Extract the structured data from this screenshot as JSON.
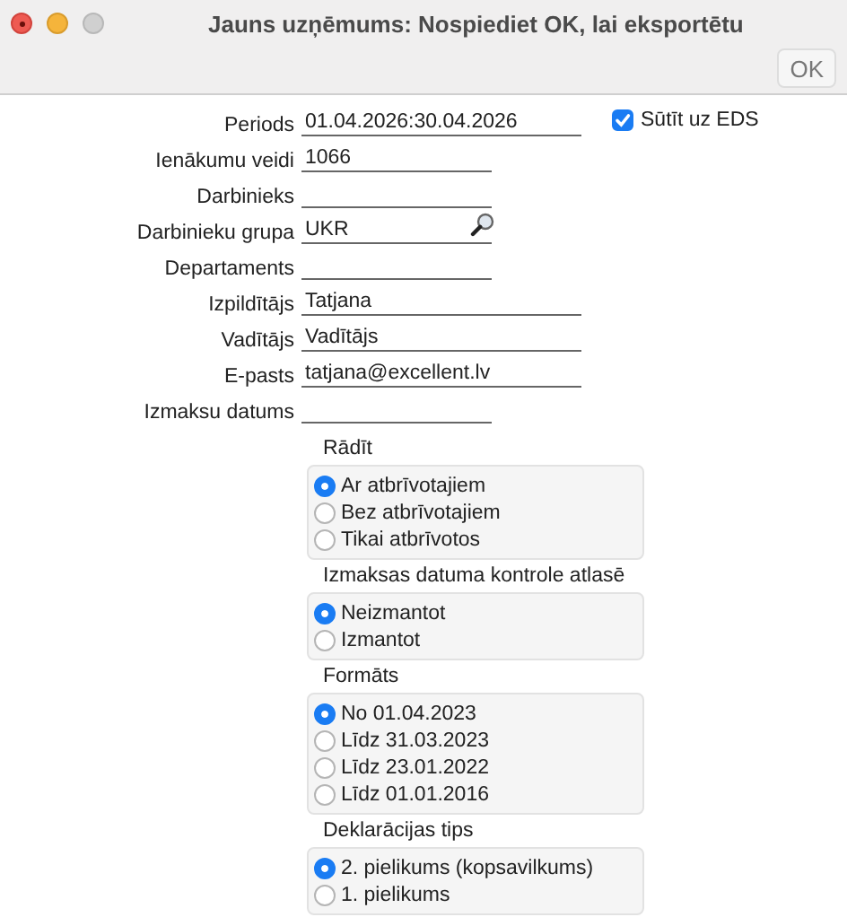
{
  "window": {
    "title": "Jauns uzņēmums: Nospiediet OK, lai eksportētu"
  },
  "toolbar": {
    "ok_button": "OK"
  },
  "fields": [
    {
      "label": "Periods",
      "value": "01.04.2026:30.04.2026",
      "wide": true,
      "lookup": false
    },
    {
      "label": "Ienākumu veidi",
      "value": "1066",
      "wide": false,
      "lookup": false
    },
    {
      "label": "Darbinieks",
      "wide": false,
      "lookup": false
    },
    {
      "label": "Darbinieku grupa",
      "value": "UKR",
      "wide": false,
      "lookup": true
    },
    {
      "label": "Departaments",
      "wide": false,
      "lookup": false
    },
    {
      "label": "Izpildītājs",
      "value": "Tatjana",
      "wide": true,
      "lookup": false
    },
    {
      "label": "Vadītājs",
      "value": "Vadītājs",
      "wide": true,
      "lookup": false
    },
    {
      "label": "E-pasts",
      "value": "tatjana@excellent.lv",
      "wide": true,
      "lookup": false
    },
    {
      "label": "Izmaksu datums",
      "wide": false,
      "lookup": false
    }
  ],
  "send_checkbox": {
    "label": "Sūtīt uz EDS",
    "checked": true
  },
  "groups": [
    {
      "title": "Rādīt",
      "options": [
        {
          "label": "Ar atbrīvotajiem",
          "selected": true
        },
        {
          "label": "Bez atbrīvotajiem",
          "selected": false
        },
        {
          "label": "Tikai atbrīvotos",
          "selected": false
        }
      ]
    },
    {
      "title": "Izmaksas datuma kontrole atlasē",
      "options": [
        {
          "label": "Neizmantot",
          "selected": true
        },
        {
          "label": "Izmantot",
          "selected": false
        }
      ]
    },
    {
      "title": "Formāts",
      "options": [
        {
          "label": "No 01.04.2023",
          "selected": true
        },
        {
          "label": "Līdz 31.03.2023",
          "selected": false
        },
        {
          "label": "Līdz 23.01.2022",
          "selected": false
        },
        {
          "label": "Līdz 01.01.2016",
          "selected": false
        }
      ]
    },
    {
      "title": "Deklarācijas tips",
      "options": [
        {
          "label": "2. pielikums (kopsavilkums)",
          "selected": true
        },
        {
          "label": "1. pielikums",
          "selected": false
        }
      ]
    }
  ]
}
